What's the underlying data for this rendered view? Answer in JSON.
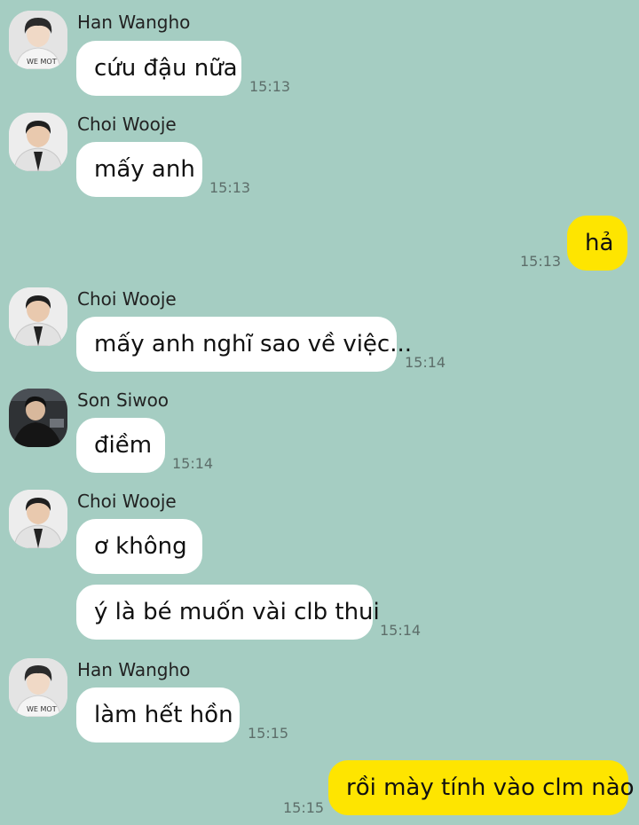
{
  "colors": {
    "background": "#a5cdc2",
    "incoming_bubble": "#ffffff",
    "outgoing_bubble": "#fee500",
    "timestamp": "#5d6e6a"
  },
  "messages": [
    {
      "sender": "Han Wangho",
      "avatar": "han-wangho-avatar",
      "text": "cứu đậu nữa",
      "time": "15:13"
    },
    {
      "sender": "Choi Wooje",
      "avatar": "choi-wooje-avatar",
      "text": "mấy anh",
      "time": "15:13"
    },
    {
      "sender": "me",
      "text": "hả",
      "time": "15:13"
    },
    {
      "sender": "Choi Wooje",
      "avatar": "choi-wooje-avatar",
      "text": "mấy anh nghĩ sao về việc...",
      "time": "15:14"
    },
    {
      "sender": "Son Siwoo",
      "avatar": "son-siwoo-avatar",
      "text": "điềm",
      "time": "15:14"
    },
    {
      "sender": "Choi Wooje",
      "avatar": "choi-wooje-avatar",
      "text": "ơ không",
      "time": ""
    },
    {
      "sender": "Choi Wooje",
      "text": "ý là bé muốn vài clb thui",
      "time": "15:14"
    },
    {
      "sender": "Han Wangho",
      "avatar": "han-wangho-avatar",
      "text": "làm hết hồn",
      "time": "15:15"
    },
    {
      "sender": "me",
      "text": "rồi mày tính vào clm nào",
      "time": "15:15"
    }
  ]
}
